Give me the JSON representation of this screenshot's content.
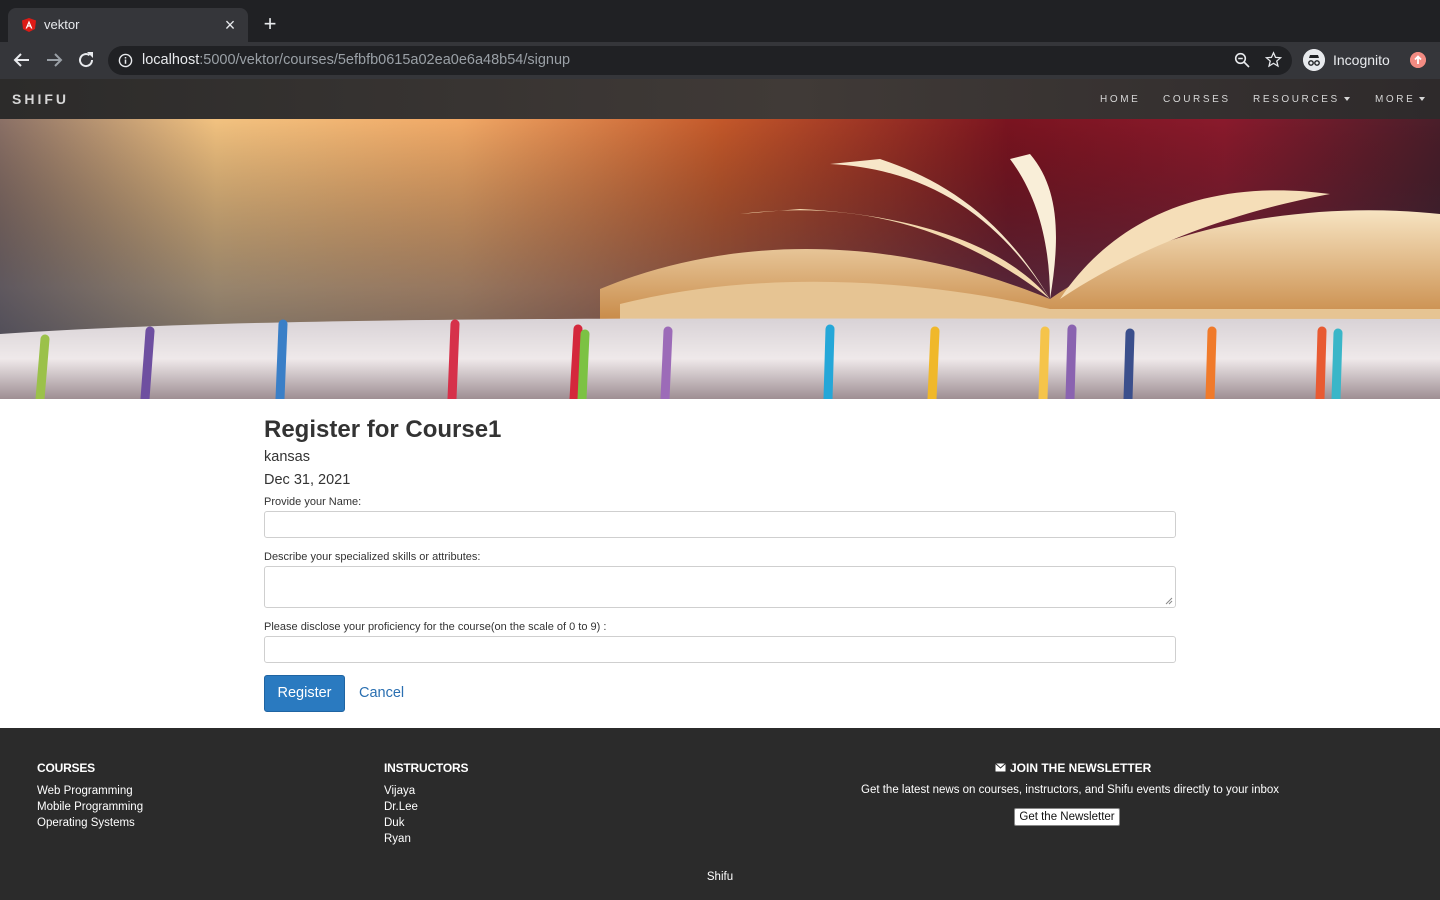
{
  "browser": {
    "tab_title": "vektor",
    "url_host": "localhost",
    "url_rest": ":5000/vektor/courses/5efbfb0615a02ea0e6a48b54/signup",
    "profile_label": "Incognito"
  },
  "site": {
    "brand": "SHIFU",
    "nav": {
      "home": "HOME",
      "courses": "COURSES",
      "resources": "RESOURCES",
      "more": "MORE"
    }
  },
  "form": {
    "title": "Register for Course1",
    "location": "kansas",
    "date": "Dec 31, 2021",
    "name_label": "Provide your Name:",
    "name_value": "",
    "skills_label": "Describe your specialized skills or attributes:",
    "skills_value": "",
    "proficiency_label": "Please disclose your proficiency for the course(on the scale of 0 to 9) :",
    "proficiency_value": "",
    "register_label": "Register",
    "cancel_label": "Cancel"
  },
  "footer": {
    "courses_title": "COURSES",
    "courses": [
      "Web Programming",
      "Mobile Programming",
      "Operating Systems"
    ],
    "instructors_title": "INSTRUCTORS",
    "instructors": [
      "Vijaya",
      "Dr.Lee",
      "Duk",
      "Ryan"
    ],
    "newsletter_title": "JOIN THE NEWSLETTER",
    "newsletter_text": "Get the latest news on courses, instructors, and Shifu events directly to your inbox",
    "newsletter_button": "Get the Newsletter",
    "copyright": "Shifu"
  },
  "colors": {
    "chrome_dark": "#202124",
    "chrome_toolbar": "#35363a",
    "primary_button": "#2a7ac0",
    "link": "#2a6fb1",
    "footer_bg": "#2b2b2b"
  }
}
